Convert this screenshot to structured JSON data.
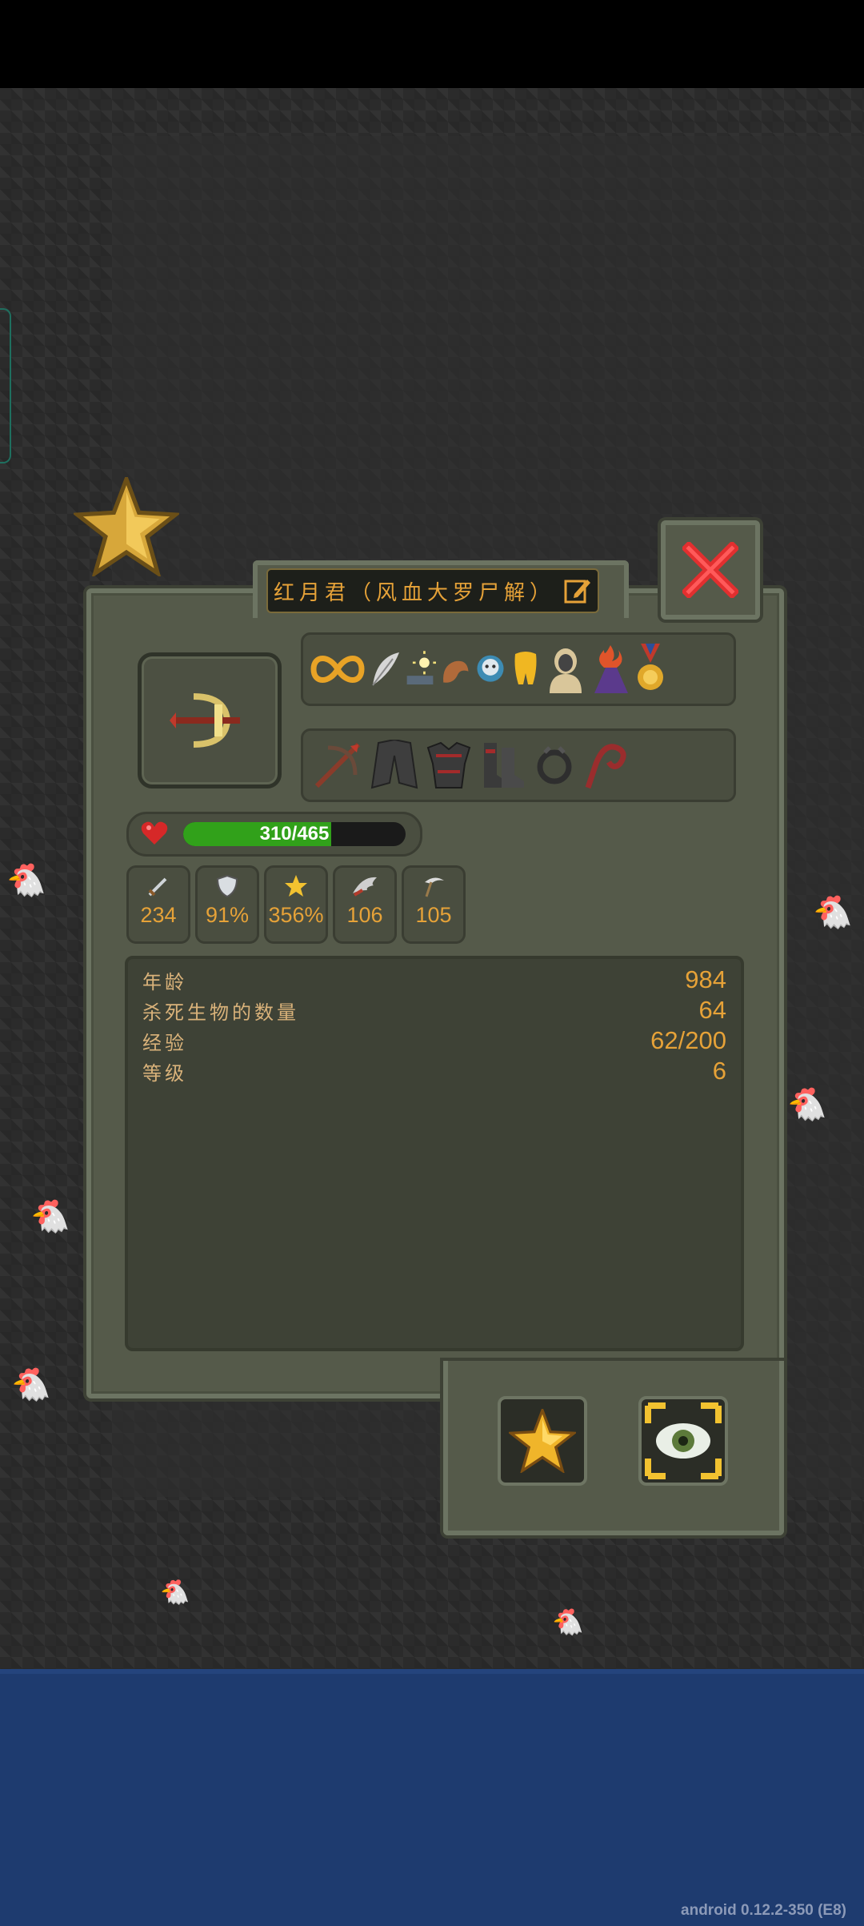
{
  "window": {
    "title": "红月君（风血大罗尸解）",
    "edit_icon": "pencil-edit-icon",
    "close_icon": "close-x-icon"
  },
  "hero": {
    "portrait_icon": "crossbow-hero-portrait",
    "buffs": [
      "infinity-buff-icon",
      "feather-buff-icon",
      "light-buff-icon",
      "strength-arm-buff-icon",
      "ghost-buff-icon",
      "golden-tooth-buff-icon",
      "statue-buff-icon",
      "fire-wizard-buff-icon",
      "medal-buff-icon"
    ],
    "equipment": [
      "crossbow-weapon-icon",
      "cloak-armor-icon",
      "heavy-armor-icon",
      "boots-icon",
      "ring-icon",
      "whip-artifact-icon"
    ],
    "hp": {
      "current": 310,
      "max": 465,
      "text": "310/465",
      "fraction": 0.667
    }
  },
  "stats": [
    {
      "icon": "sword-attack-icon",
      "value": "234"
    },
    {
      "icon": "shield-defense-icon",
      "value": "91%"
    },
    {
      "icon": "star-crit-icon",
      "value": "356%"
    },
    {
      "icon": "wing-speed-icon",
      "value": "106"
    },
    {
      "icon": "scythe-icon",
      "value": "105"
    }
  ],
  "info": [
    {
      "label": "年龄",
      "value": "984"
    },
    {
      "label": "杀死生物的数量",
      "value": "64"
    },
    {
      "label": "经验",
      "value": "62/200"
    },
    {
      "label": "等级",
      "value": "6"
    }
  ],
  "buttons": {
    "star_icon": "star-button-icon",
    "eye_icon": "eye-watch-icon"
  },
  "footer": {
    "version": "android 0.12.2-350 (E8)"
  },
  "colors": {
    "accent": "#e6a238",
    "panel": "#555a4a",
    "water": "#1e3b6f",
    "hp_fill": "#31a11a"
  }
}
